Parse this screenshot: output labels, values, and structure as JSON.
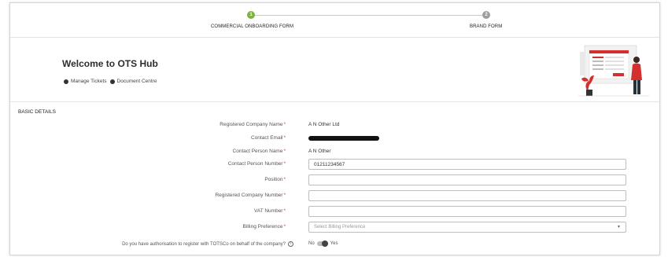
{
  "stepper": {
    "steps": [
      {
        "number": "1",
        "label": "COMMERCIAL ONBOARDING FORM",
        "state": "active"
      },
      {
        "number": "2",
        "label": "BRAND FORM",
        "state": "inactive"
      }
    ],
    "active_color": "#7cb342",
    "inactive_color": "#9e9e9e"
  },
  "welcome": {
    "title": "Welcome to OTS Hub",
    "links": [
      "Manage Tickets",
      "Document Centre"
    ],
    "illustration_icon": "onboarding-form-illustration"
  },
  "basic_details": {
    "section_title": "BASIC DETAILS",
    "fields": {
      "registered_company_name": {
        "label": "Registered Company Name",
        "value": "A N Other Ltd"
      },
      "contact_email": {
        "label": "Contact Email"
      },
      "contact_person_name": {
        "label": "Contact Person Name",
        "value": "A N Other"
      },
      "contact_person_number": {
        "label": "Contact Person Number",
        "value": "01211234567"
      },
      "position": {
        "label": "Position",
        "value": ""
      },
      "registered_company_number": {
        "label": "Registered Company Number",
        "value": ""
      },
      "vat_number": {
        "label": "VAT Number",
        "value": ""
      },
      "billing_preference": {
        "label": "Billing Preference",
        "placeholder": "Select Billing Preference"
      }
    },
    "required_marker": "*",
    "authorisation": {
      "question": "Do you have authorisation to register with TOTSCo on behalf of the company?",
      "no_label": "No",
      "yes_label": "Yes"
    }
  },
  "colors": {
    "required": "#e53935",
    "accent_red": "#d32f2f"
  }
}
